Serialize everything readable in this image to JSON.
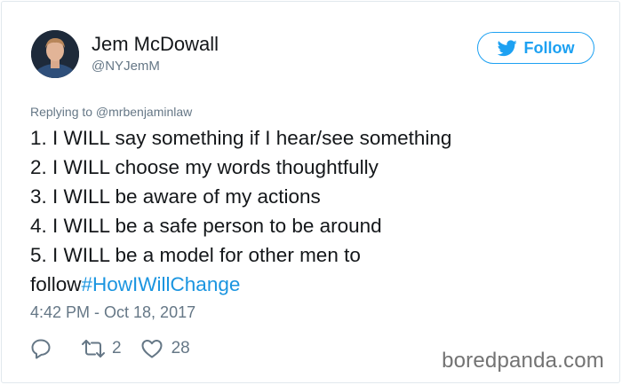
{
  "tweet": {
    "author": {
      "name": "Jem McDowall",
      "handle": "@NYJemM"
    },
    "follow_label": "Follow",
    "reply_to": "Replying to @mrbenjaminlaw",
    "lines": [
      "1. I WILL say something if I hear/see something",
      "2. I WILL choose my words thoughtfully",
      "3. I WILL be aware of my actions",
      "4. I WILL be a safe person to be around",
      "5. I WILL be a model for other men to"
    ],
    "last_line_text": "follow",
    "hashtag": "#HowIWillChange",
    "timestamp": "4:42 PM - Oct 18, 2017",
    "stats": {
      "retweets": "2",
      "likes": "28"
    }
  },
  "watermark": "boredpanda.com",
  "colors": {
    "twitter_blue": "#1da1f2",
    "hashtag_blue": "#1b95e0",
    "text": "#14171a",
    "muted": "#657786"
  },
  "icons": {
    "follow": "twitter-bird-icon",
    "reply": "reply-icon",
    "retweet": "retweet-icon",
    "like": "heart-icon"
  }
}
